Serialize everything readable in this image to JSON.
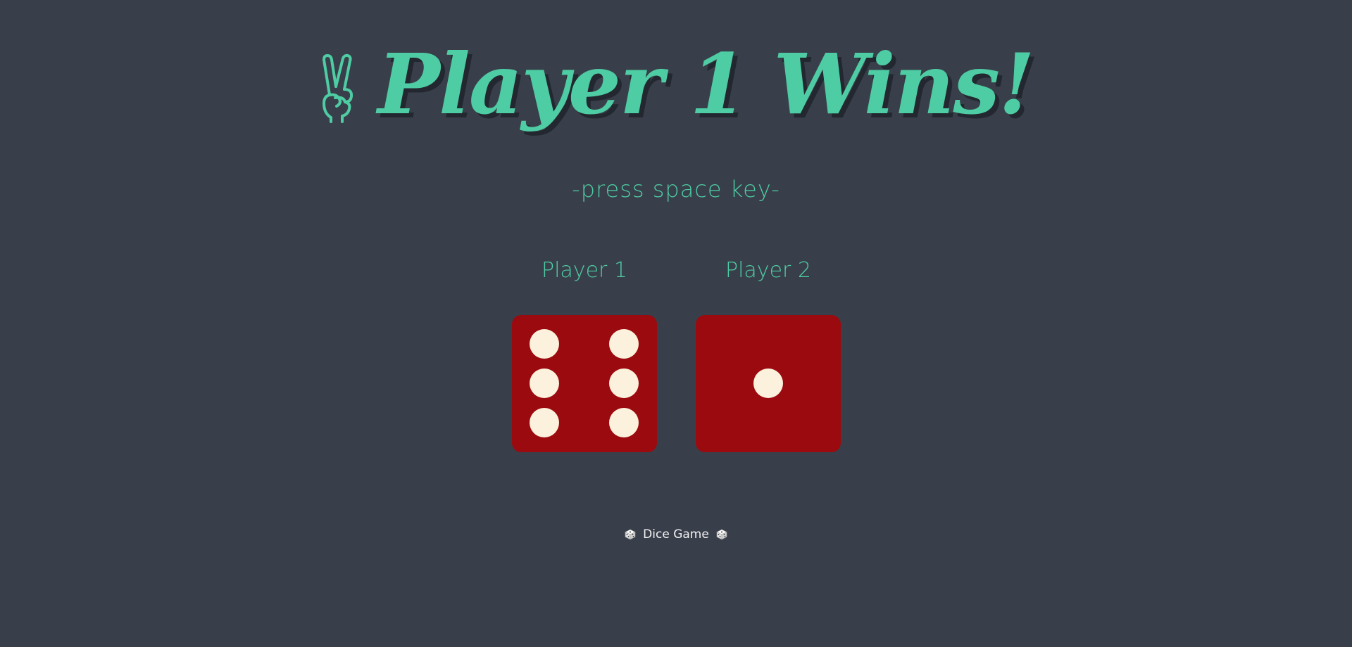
{
  "header": {
    "icon": "victory-hand-icon",
    "title": "Player 1 Wins!"
  },
  "instruction": "-press space key-",
  "players": [
    {
      "label": "Player 1",
      "die_value": 6
    },
    {
      "label": "Player 2",
      "die_value": 1
    }
  ],
  "footer": {
    "left_icon": "dice-icon",
    "text": "Dice Game",
    "right_icon": "dice-icon"
  },
  "colors": {
    "background": "#393f4a",
    "accent": "#4ecca3",
    "die_face": "#9b0a0e",
    "pip": "#fbf1dd",
    "footer_text": "#f1f1f1"
  }
}
